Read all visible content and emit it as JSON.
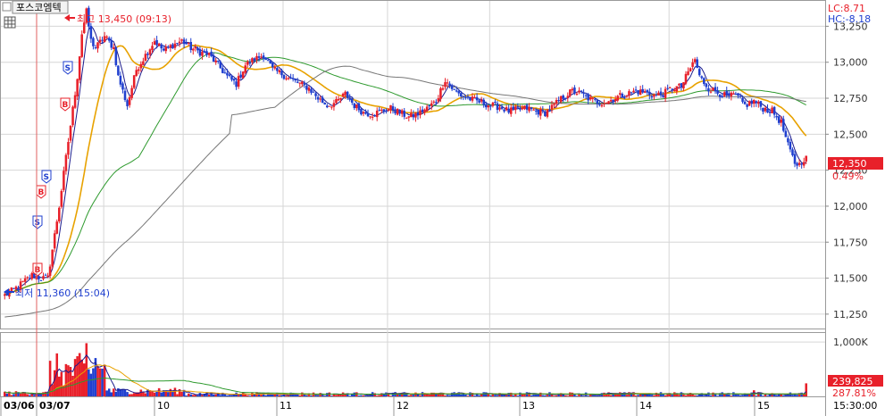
{
  "header": {
    "stock_name": "포스코엠텍",
    "lc_label": "LC:8.71",
    "hc_label": "HC:-8.18"
  },
  "annotations": {
    "high_label": "최고 13,450 (09:13)",
    "low_label": "최저 11,360 (15:04)"
  },
  "price_box": {
    "current": "12,350",
    "change": "0.49%"
  },
  "volume_box": {
    "current": "239,825",
    "ratio": "287.81%"
  },
  "time_label": "15:30:00",
  "signals": [
    "B",
    "S",
    "B",
    "S",
    "B",
    "S"
  ],
  "colors": {
    "up": "#e8202a",
    "down": "#1f3fcf",
    "ma_short": "#1a1a8c",
    "ma_mid": "#e8a200",
    "ma_long": "#2e9a2e",
    "ma_longest": "#777777",
    "grid": "#d6d6d6",
    "marker_line": "#e06060"
  },
  "chart_data": {
    "type": "line",
    "title": "포스코엠텍",
    "y_axis": {
      "ticks": [
        11250,
        11500,
        11750,
        12000,
        12250,
        12500,
        12750,
        13000,
        13250
      ],
      "tick_labels": [
        "11,250",
        "11,500",
        "11,750",
        "12,000",
        "12,250",
        "12,500",
        "12,750",
        "13,000",
        "13,250"
      ],
      "range": [
        11150,
        13420
      ]
    },
    "volume_axis": {
      "ticks": [
        1000000
      ],
      "tick_labels": [
        "1,000K"
      ],
      "range": [
        0,
        1150000
      ]
    },
    "x_axis": {
      "labels": [
        "03/06",
        "03/07",
        "10",
        "11",
        "12",
        "13",
        "14",
        "15"
      ]
    },
    "price_series": {
      "name": "price",
      "anchors": [
        [
          0,
          11380
        ],
        [
          4,
          11420
        ],
        [
          8,
          11470
        ],
        [
          12,
          11520
        ],
        [
          16,
          11500
        ],
        [
          19,
          11500
        ],
        [
          20,
          11600
        ],
        [
          24,
          12000
        ],
        [
          28,
          12450
        ],
        [
          32,
          12900
        ],
        [
          34,
          13200
        ],
        [
          36,
          13350
        ],
        [
          38,
          13150
        ],
        [
          40,
          13100
        ],
        [
          44,
          13180
        ],
        [
          48,
          13100
        ],
        [
          50,
          12900
        ],
        [
          54,
          12700
        ],
        [
          58,
          12950
        ],
        [
          62,
          13050
        ],
        [
          66,
          13150
        ],
        [
          70,
          13080
        ],
        [
          74,
          13120
        ],
        [
          78,
          13150
        ],
        [
          82,
          13100
        ],
        [
          86,
          13070
        ],
        [
          90,
          13050
        ],
        [
          94,
          12980
        ],
        [
          98,
          12900
        ],
        [
          102,
          12850
        ],
        [
          106,
          12980
        ],
        [
          110,
          13020
        ],
        [
          114,
          13050
        ],
        [
          118,
          12950
        ],
        [
          122,
          12920
        ],
        [
          126,
          12880
        ],
        [
          130,
          12850
        ],
        [
          134,
          12820
        ],
        [
          138,
          12750
        ],
        [
          142,
          12700
        ],
        [
          146,
          12720
        ],
        [
          150,
          12780
        ],
        [
          154,
          12700
        ],
        [
          158,
          12650
        ],
        [
          162,
          12640
        ],
        [
          166,
          12660
        ],
        [
          170,
          12680
        ],
        [
          174,
          12650
        ],
        [
          178,
          12620
        ],
        [
          182,
          12640
        ],
        [
          186,
          12680
        ],
        [
          190,
          12730
        ],
        [
          194,
          12880
        ],
        [
          198,
          12800
        ],
        [
          202,
          12760
        ],
        [
          206,
          12740
        ],
        [
          210,
          12720
        ],
        [
          214,
          12700
        ],
        [
          218,
          12690
        ],
        [
          222,
          12660
        ],
        [
          226,
          12670
        ],
        [
          230,
          12680
        ],
        [
          234,
          12660
        ],
        [
          238,
          12650
        ],
        [
          242,
          12700
        ],
        [
          246,
          12760
        ],
        [
          250,
          12800
        ],
        [
          254,
          12780
        ],
        [
          258,
          12740
        ],
        [
          262,
          12720
        ],
        [
          266,
          12730
        ],
        [
          270,
          12760
        ],
        [
          274,
          12780
        ],
        [
          278,
          12800
        ],
        [
          282,
          12790
        ],
        [
          286,
          12770
        ],
        [
          290,
          12780
        ],
        [
          294,
          12820
        ],
        [
          298,
          12830
        ],
        [
          302,
          12960
        ],
        [
          304,
          13020
        ],
        [
          306,
          12900
        ],
        [
          310,
          12820
        ],
        [
          314,
          12790
        ],
        [
          318,
          12760
        ],
        [
          322,
          12770
        ],
        [
          326,
          12700
        ],
        [
          330,
          12730
        ],
        [
          334,
          12680
        ],
        [
          338,
          12660
        ],
        [
          342,
          12580
        ],
        [
          345,
          12420
        ],
        [
          348,
          12300
        ],
        [
          350,
          12290
        ],
        [
          352,
          12330
        ],
        [
          353,
          12350
        ]
      ],
      "total_bars": 354
    },
    "moving_averages": [
      {
        "name": "ma5",
        "period": 5
      },
      {
        "name": "ma20",
        "period": 20
      },
      {
        "name": "ma60",
        "period": 60
      },
      {
        "name": "ma120",
        "period": 120
      }
    ],
    "high": 13450,
    "low": 11360,
    "current": 12350,
    "change_pct": 0.49,
    "volume_current": 239825,
    "volume_ratio_pct": 287.81
  }
}
